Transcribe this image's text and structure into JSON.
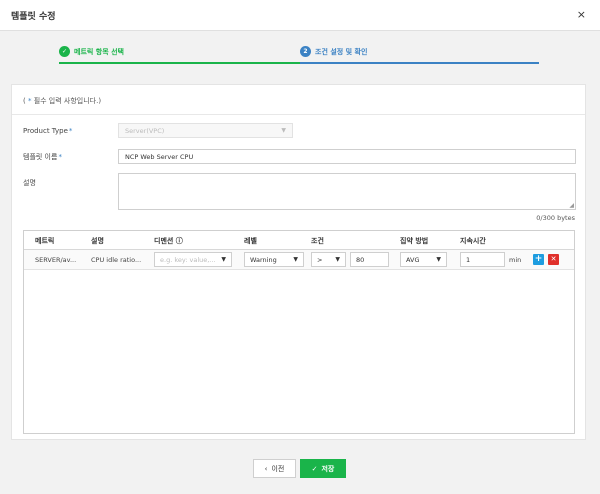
{
  "dialog": {
    "title": "템플릿 수정",
    "close_icon": "×"
  },
  "steps": [
    {
      "icon": "check-icon",
      "glyph": "✓",
      "label": "메트릭 항목 선택",
      "state": "done",
      "color": "#1ab44a"
    },
    {
      "icon": "step-number",
      "glyph": "2",
      "label": "조건 설정 및 확인",
      "state": "active",
      "color": "#3b82c4"
    }
  ],
  "form": {
    "required_note_prefix": "( ",
    "required_note_star": "*",
    "required_note_text": " 필수 입력 사항입니다.)",
    "product_type": {
      "label": "Product Type",
      "value": "Server(VPC)"
    },
    "template_name": {
      "label": "템플릿 이름",
      "value": "NCP Web Server CPU"
    },
    "description": {
      "label": "설명",
      "value": "",
      "byte_count": "0/300 bytes"
    }
  },
  "table": {
    "headers": [
      "메트릭",
      "설명",
      "디멘션 ⓘ",
      "레벨",
      "조건",
      "집약 방법",
      "지속시간"
    ],
    "rows": [
      {
        "metric": "SERVER/av...",
        "description": "CPU idle ratio...",
        "dimension_placeholder": "e.g. key: value,...",
        "level": "Warning",
        "operator": ">",
        "threshold": "80",
        "aggregation": "AVG",
        "duration": "1",
        "duration_unit": "min"
      }
    ]
  },
  "buttons": {
    "prev": {
      "label": "이전",
      "icon": "chevron-left-icon",
      "glyph": "‹"
    },
    "save": {
      "label": "저장",
      "icon": "check-icon",
      "glyph": "✓"
    }
  },
  "colors": {
    "primary_green": "#1ab44a",
    "primary_blue": "#3b82c4",
    "add_button": "#1e9de0",
    "delete_button": "#e0302b"
  }
}
